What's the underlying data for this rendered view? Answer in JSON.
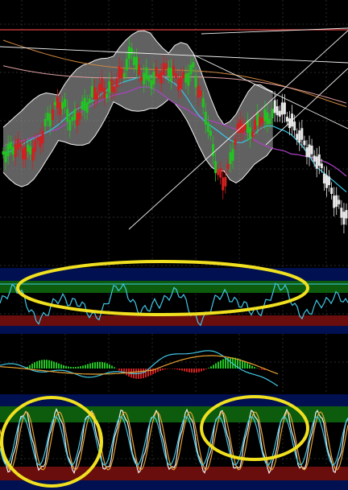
{
  "chart_data": {
    "type": "line",
    "title": "",
    "colors": {
      "background": "#000000",
      "grid": "#2a2a2a",
      "candle_up": "#22c322",
      "candle_down": "#d02020",
      "bollinger_band_fill": "#8a8a8a",
      "bollinger_band_line": "#f0f0f0",
      "ma_cyan": "#35c8e6",
      "ma_magenta": "#b040c8",
      "ma_orange": "#d08840",
      "ma_pink": "#e0a0a0",
      "resistance_line": "#e04040",
      "trendline": "#f0f0f0",
      "overbought_band": "#0d5c0d",
      "oversold_band": "#6a0d0d",
      "upper_bar": "#001050",
      "oscillator_cyan": "#40c8e6",
      "oscillator_orange": "#e8a030",
      "oscillator_white": "#f0f0f0",
      "macd_line": "#40c8e6",
      "signal_line": "#e8a030",
      "highlight_ellipse": "#f0e020"
    },
    "panels": [
      {
        "name": "price",
        "indicators": [
          "candles",
          "bollinger-bands",
          "moving-averages",
          "trendlines"
        ],
        "price_path": [
          0.4,
          0.41,
          0.43,
          0.42,
          0.4,
          0.42,
          0.46,
          0.55,
          0.6,
          0.65,
          0.63,
          0.55,
          0.58,
          0.62,
          0.66,
          0.7,
          0.72,
          0.7,
          0.73,
          0.78,
          0.82,
          0.92,
          0.8,
          0.78,
          0.76,
          0.78,
          0.8,
          0.82,
          0.78,
          0.75,
          0.78,
          0.82,
          0.7,
          0.6,
          0.45,
          0.3,
          0.25,
          0.35,
          0.48,
          0.55,
          0.5,
          0.52,
          0.58,
          0.56,
          0.6,
          0.62,
          0.6,
          0.55,
          0.5,
          0.46,
          0.4,
          0.38,
          0.32,
          0.25,
          0.18,
          0.12,
          0.08
        ]
      },
      {
        "name": "oscillator-1",
        "bands": [
          "overbought",
          "oversold"
        ]
      },
      {
        "name": "macd",
        "series": [
          "macd",
          "signal",
          "histogram"
        ]
      },
      {
        "name": "stochastic",
        "bands": [
          "overbought",
          "oversold"
        ]
      }
    ],
    "annotations": [
      {
        "type": "ellipse",
        "panel": "oscillator-1"
      },
      {
        "type": "ellipse",
        "panel": "stochastic",
        "side": "left"
      },
      {
        "type": "ellipse",
        "panel": "stochastic",
        "side": "right"
      }
    ],
    "xlabel": "",
    "ylabel": ""
  }
}
